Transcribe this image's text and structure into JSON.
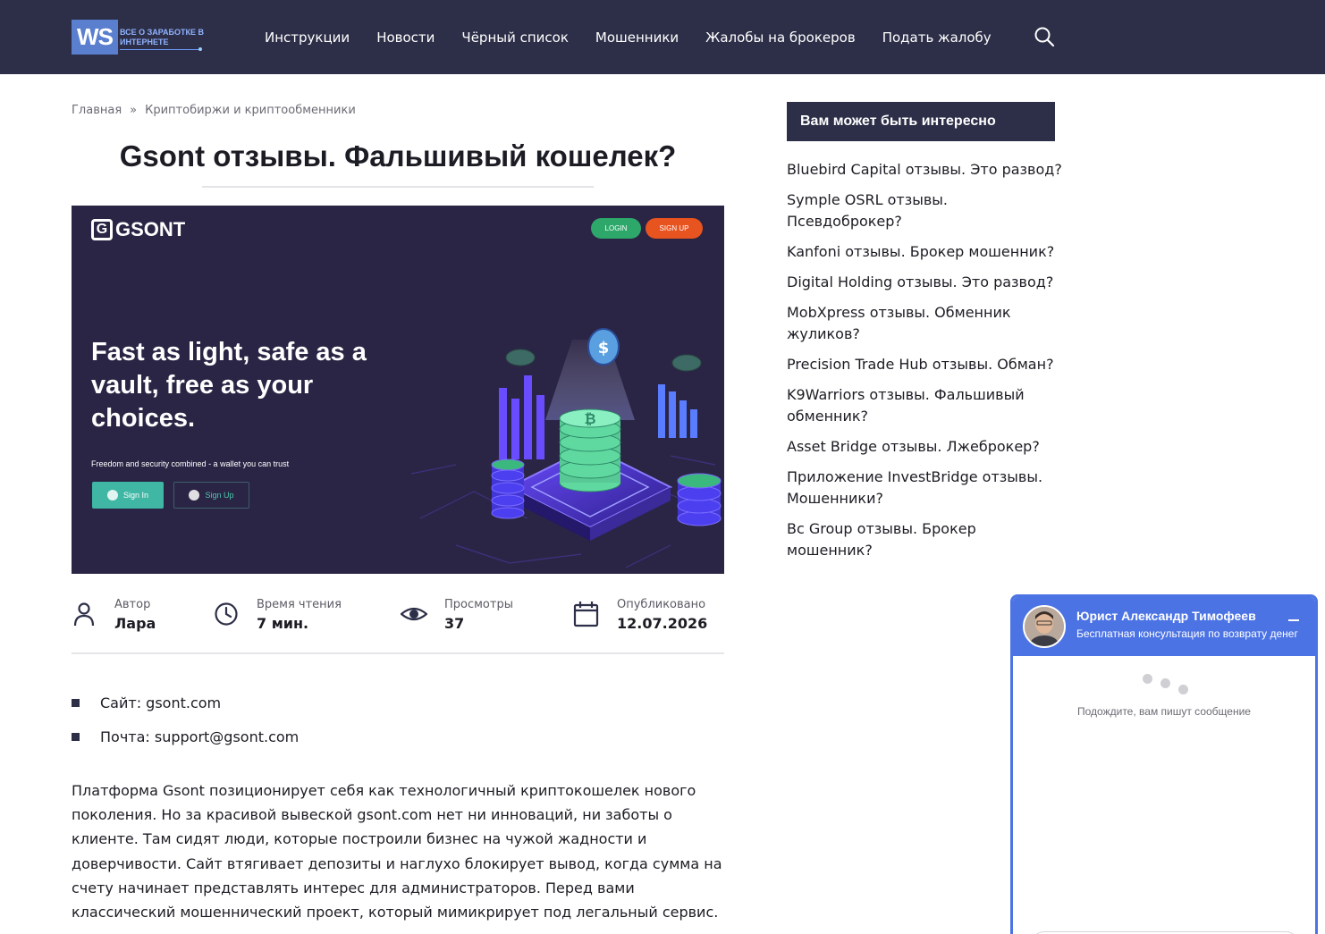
{
  "header": {
    "logo_mark": "WS",
    "logo_text": "ВСЕ О ЗАРАБОТКЕ В ИНТЕРНЕТЕ",
    "nav": [
      {
        "label": "Инструкции"
      },
      {
        "label": "Новости"
      },
      {
        "label": "Чёрный список"
      },
      {
        "label": "Мошенники"
      },
      {
        "label": "Жалобы на брокеров"
      },
      {
        "label": "Подать жалобу"
      }
    ],
    "search_icon": "search-icon"
  },
  "breadcrumb": {
    "home": "Главная",
    "separator": "»",
    "category": "Криптобиржи и криптообменники"
  },
  "article": {
    "title": "Gsont отзывы. Фальшивый кошелек?",
    "hero": {
      "logo": "GSONT",
      "login": "LOGIN",
      "signup": "SIGN UP",
      "headline": "Fast as light, safe as a vault, free as your choices.",
      "subline": "Freedom and security combined - a wallet you can trust",
      "sign_in": "Sign In",
      "sign_up": "Sign Up"
    },
    "meta": {
      "author_label": "Автор",
      "author": "Лара",
      "reading_label": "Время чтения",
      "reading": "7 мин.",
      "views_label": "Просмотры",
      "views": "37",
      "published_label": "Опубликовано",
      "published": "12.07.2026"
    },
    "info": [
      {
        "text": "Сайт: gsont.com"
      },
      {
        "text": "Почта: support@gsont.com"
      }
    ],
    "paragraph": "Платформа Gsont позиционирует себя как технологичный криптокошелек нового поколения. Но за красивой вывеской gsont.com нет ни инноваций, ни заботы о клиенте. Там сидят люди, которые построили бизнес на чужой жадности и доверчивости. Сайт втягивает депозиты и наглухо блокирует вывод, когда сумма на счету начинает представлять интерес для администраторов. Перед вами классический мошеннический проект, который мимикрирует под легальный сервис."
  },
  "sidebar": {
    "heading": "Вам может быть интересно",
    "links": [
      {
        "label": "Bluebird Capital отзывы. Это развод?"
      },
      {
        "label": "Symple OSRL отзывы. Псевдоброкер?"
      },
      {
        "label": "Kanfoni отзывы. Брокер мошенник?"
      },
      {
        "label": "Digital Holding отзывы. Это развод?"
      },
      {
        "label": "MobXpress отзывы. Обменник жуликов?"
      },
      {
        "label": "Precision Trade Hub отзывы. Обман?"
      },
      {
        "label": "K9Warriors отзывы. Фальшивый обменник?"
      },
      {
        "label": "Asset Bridge отзывы. Лжеброкер?"
      },
      {
        "label": "Приложение InvestBridge отзывы. Мошенники?"
      },
      {
        "label": "Bc Group отзывы. Брокер мошенник?"
      }
    ]
  },
  "chat": {
    "name": "Юрист Александр Тимофеев",
    "subtitle": "Бесплатная консультация по возврату денег",
    "waiting": "Подождите, вам пишут сообщение"
  },
  "colors": {
    "header_bg": "#2d2f48",
    "accent_blue": "#4b73e4",
    "hero_bg": "#2b2545",
    "login_green": "#2ea86a",
    "signup_orange": "#e8541f"
  }
}
